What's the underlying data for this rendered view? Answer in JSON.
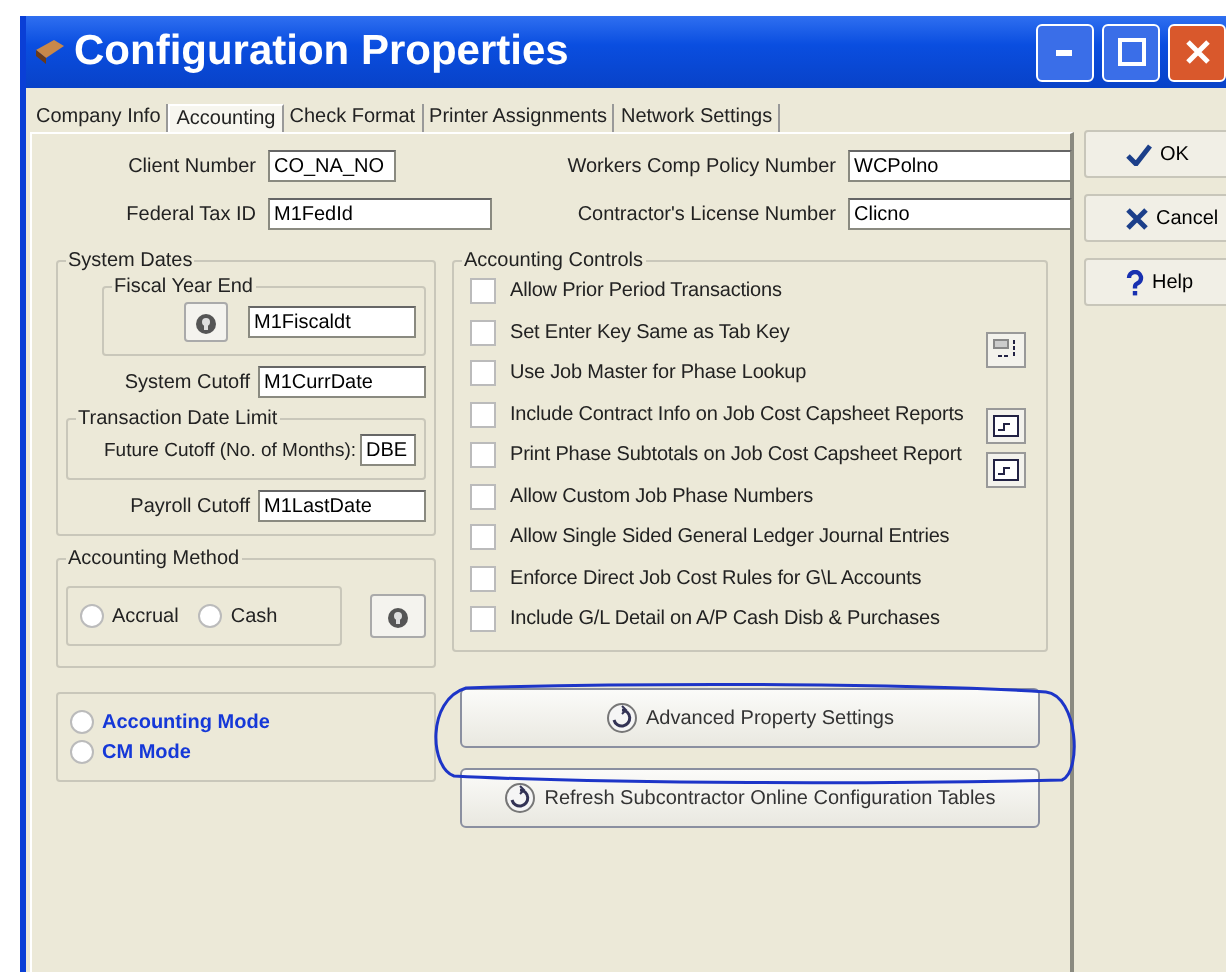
{
  "window": {
    "title": "Configuration Properties"
  },
  "tabs": [
    {
      "label": "Company Info",
      "selected": false
    },
    {
      "label": "Accounting",
      "selected": true
    },
    {
      "label": "Check Format",
      "selected": false
    },
    {
      "label": "Printer Assignments",
      "selected": false
    },
    {
      "label": "Network Settings",
      "selected": false
    }
  ],
  "top_fields": [
    {
      "label": "Client Number",
      "value": "CO_NA_NO"
    },
    {
      "label": "Workers Comp Policy Number",
      "value": "WCPolno"
    },
    {
      "label": "Federal Tax ID",
      "value": "M1FedId"
    },
    {
      "label": "Contractor's License Number",
      "value": "Clicno"
    }
  ],
  "system_dates": {
    "title": "System Dates",
    "fiscal_year_end": {
      "title": "Fiscal Year End",
      "value": "M1Fiscaldt"
    },
    "system_cutoff": {
      "label": "System Cutoff",
      "value": "M1CurrDate"
    },
    "transaction_date_limit": {
      "title": "Transaction Date Limit",
      "label": "Future Cutoff (No. of Months):",
      "value": "DBE"
    },
    "payroll_cutoff": {
      "label": "Payroll Cutoff",
      "value": "M1LastDate"
    }
  },
  "accounting_method": {
    "title": "Accounting Method",
    "options": [
      {
        "label": "Accrual",
        "selected": false
      },
      {
        "label": "Cash",
        "selected": false
      }
    ]
  },
  "modes": [
    {
      "label": "Accounting Mode",
      "selected": false
    },
    {
      "label": "CM Mode",
      "selected": false
    }
  ],
  "accounting_controls": {
    "title": "Accounting Controls",
    "items": [
      {
        "label": "Allow Prior Period Transactions",
        "checked": false
      },
      {
        "label": "Set Enter Key Same as Tab Key",
        "checked": false
      },
      {
        "label": "Use Job Master for Phase Lookup",
        "checked": false
      },
      {
        "label": "Include Contract Info on Job Cost Capsheet Reports",
        "checked": false
      },
      {
        "label": "Print Phase Subtotals on Job Cost Capsheet Report",
        "checked": false
      },
      {
        "label": "Allow Custom Job Phase Numbers",
        "checked": false
      },
      {
        "label": "Allow Single Sided General Ledger Journal Entries",
        "checked": false
      },
      {
        "label": "Enforce Direct Job Cost Rules for G\\L Accounts",
        "checked": false
      },
      {
        "label": "Include G/L Detail on A/P Cash Disb & Purchases",
        "checked": false
      }
    ]
  },
  "action_buttons": [
    "Advanced Property Settings",
    "Refresh Subcontractor Online Configuration Tables"
  ],
  "dialog_buttons": [
    {
      "label": "OK",
      "kind": "ok"
    },
    {
      "label": "Cancel",
      "kind": "cancel"
    },
    {
      "label": "Help",
      "kind": "help"
    }
  ]
}
